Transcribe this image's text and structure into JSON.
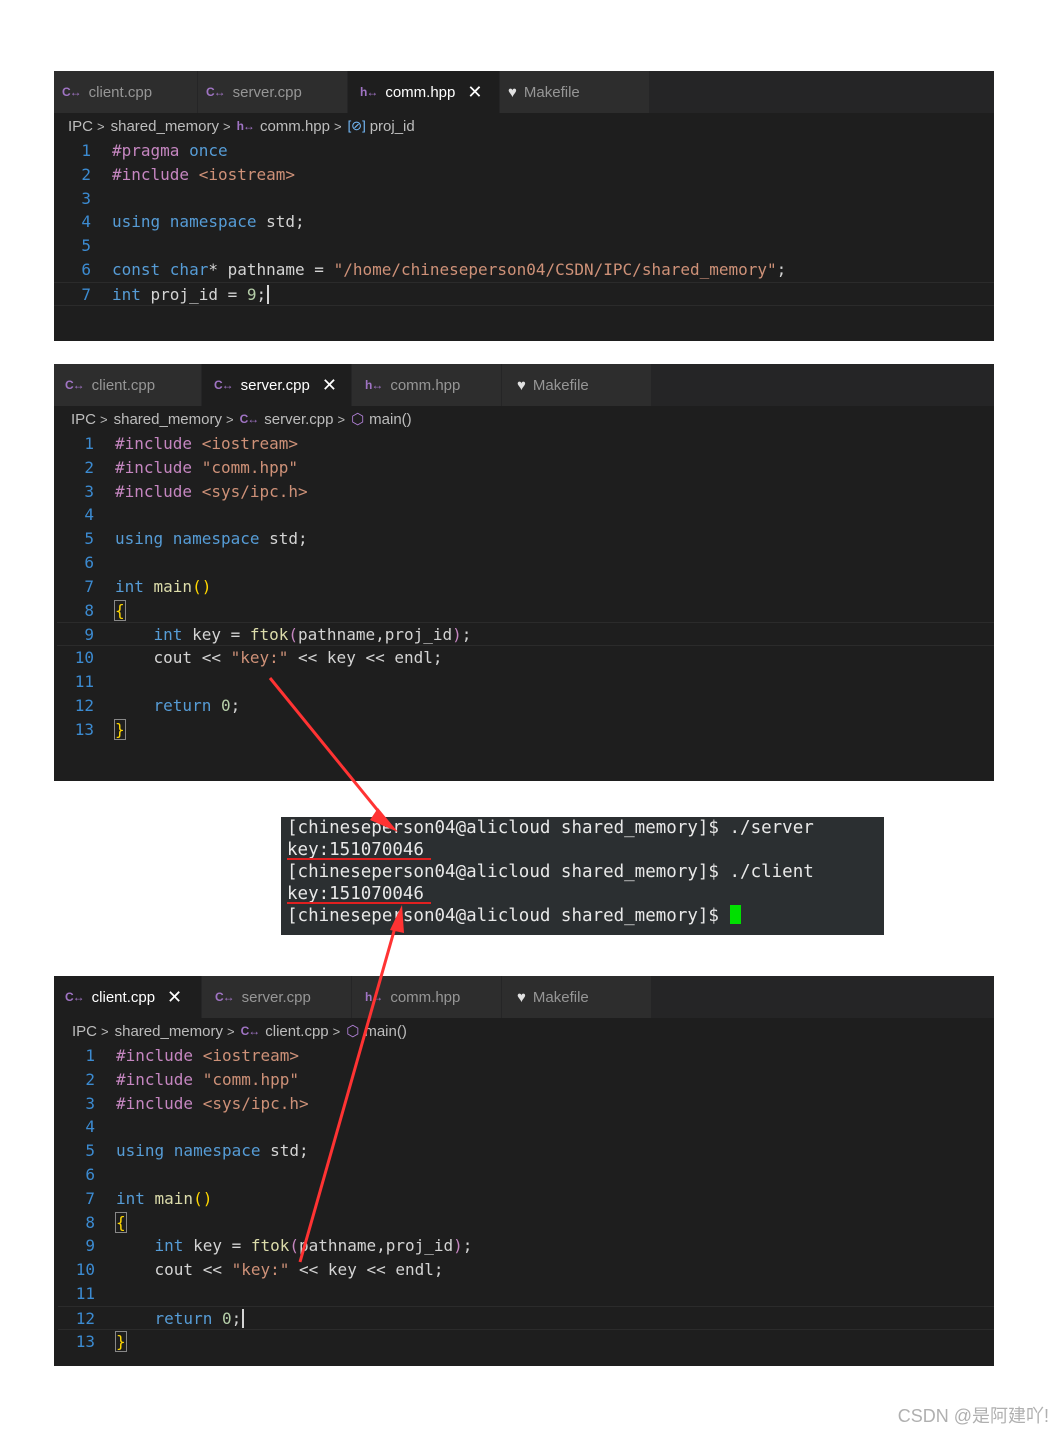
{
  "editor1": {
    "tabs": [
      {
        "label": "client.cpp",
        "icon": "C↔",
        "active": false
      },
      {
        "label": "server.cpp",
        "icon": "C↔",
        "active": false
      },
      {
        "label": "comm.hpp",
        "icon": "h↔",
        "active": true
      },
      {
        "label": "Makefile",
        "icon": "makefile-icon",
        "active": false
      }
    ],
    "breadcrumb": [
      "IPC",
      "shared_memory",
      "comm.hpp",
      "proj_id"
    ],
    "line_numbers": [
      "1",
      "2",
      "3",
      "4",
      "5",
      "6",
      "7"
    ]
  },
  "editor2": {
    "tabs": [
      {
        "label": "client.cpp",
        "icon": "C↔",
        "active": false
      },
      {
        "label": "server.cpp",
        "icon": "C↔",
        "active": true
      },
      {
        "label": "comm.hpp",
        "icon": "h↔",
        "active": false
      },
      {
        "label": "Makefile",
        "icon": "makefile-icon",
        "active": false
      }
    ],
    "breadcrumb": [
      "IPC",
      "shared_memory",
      "server.cpp",
      "main()"
    ],
    "line_numbers": [
      "1",
      "2",
      "3",
      "4",
      "5",
      "6",
      "7",
      "8",
      "9",
      "10",
      "11",
      "12",
      "13"
    ]
  },
  "editor3": {
    "tabs": [
      {
        "label": "client.cpp",
        "icon": "C↔",
        "active": true
      },
      {
        "label": "server.cpp",
        "icon": "C↔",
        "active": false
      },
      {
        "label": "comm.hpp",
        "icon": "h↔",
        "active": false
      },
      {
        "label": "Makefile",
        "icon": "makefile-icon",
        "active": false
      }
    ],
    "breadcrumb": [
      "IPC",
      "shared_memory",
      "client.cpp",
      "main()"
    ],
    "line_numbers": [
      "1",
      "2",
      "3",
      "4",
      "5",
      "6",
      "7",
      "8",
      "9",
      "10",
      "11",
      "12",
      "13"
    ]
  },
  "code": {
    "comm": {
      "l1a": "#pragma ",
      "l1b": "once",
      "l2a": "#include ",
      "l2b": "<iostream>",
      "l4a": "using ",
      "l4b": "namespace ",
      "l4c": "std;",
      "l6a": "const ",
      "l6b": "char",
      "l6c": "* pathname = ",
      "l6d": "\"/home/chineseperson04/CSDN/IPC/shared_memory\"",
      "l6e": ";",
      "l7a": "int ",
      "l7b": "proj_id = ",
      "l7c": "9",
      "l7d": ";"
    },
    "main": {
      "inc1a": "#include ",
      "inc1b": "<iostream>",
      "inc2a": "#include ",
      "inc2b": "\"comm.hpp\"",
      "inc3a": "#include ",
      "inc3b": "<sys/ipc.h>",
      "usingA": "using ",
      "usingB": "namespace ",
      "usingC": "std;",
      "mainA": "int ",
      "mainB": "main",
      "mainC": "()",
      "open": "{",
      "k1": "    ",
      "k2": "int ",
      "k3": "key = ",
      "k4": "ftok",
      "k5": "(",
      "k6": "pathname,proj_id",
      "k7": ")",
      "k8": ";",
      "c1": "    cout << ",
      "c2": "\"key:\"",
      "c3": " << key << endl;",
      "r1": "    ",
      "r2": "return ",
      "r3": "0",
      "r4": ";",
      "close": "}"
    }
  },
  "terminal": {
    "lines": [
      "[chineseperson04@alicloud shared_memory]$ ./server",
      "key:151070046",
      "[chineseperson04@alicloud shared_memory]$ ./client",
      "key:151070046",
      "[chineseperson04@alicloud shared_memory]$ "
    ]
  },
  "watermark": "CSDN @是阿建吖!",
  "colors": {
    "arrow": "#ff3333",
    "underline": "#e02020",
    "cursor": "#00e000"
  }
}
